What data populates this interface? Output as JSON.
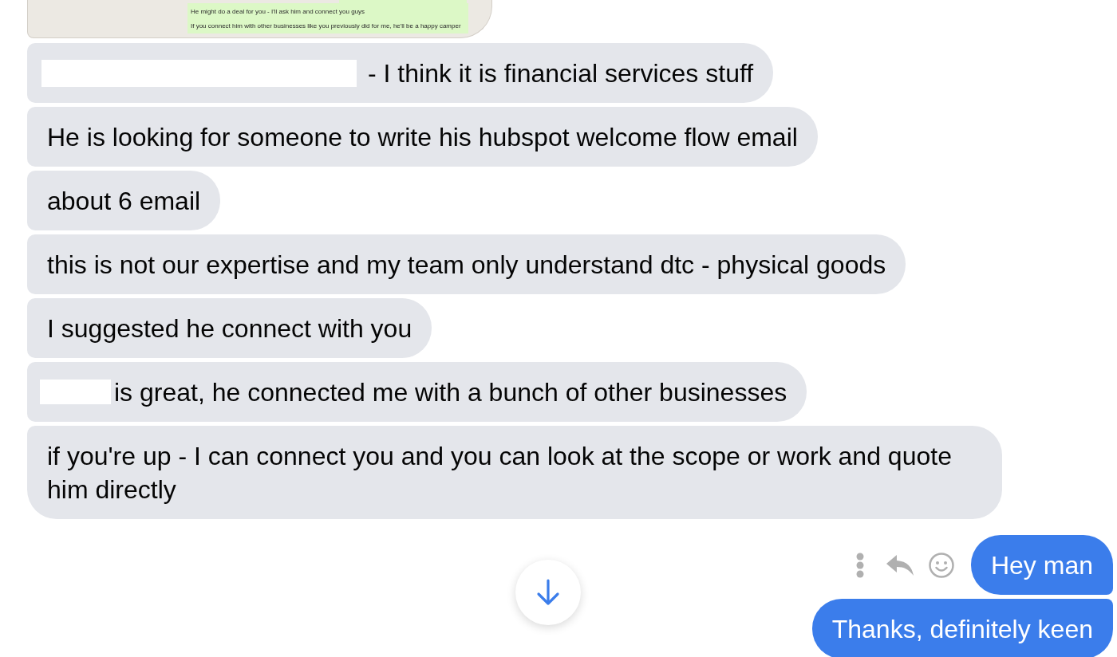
{
  "shared_image": {
    "kind": "chat-screenshot",
    "lines": [
      {
        "text": "He might do a deal for you - I'll ask him and connect you guys"
      },
      {
        "text": "If you connect him with other businesses like you previously did for me, he'll be a happy camper"
      }
    ]
  },
  "messages": [
    {
      "kind": "incoming",
      "redaction": {
        "kind": "long"
      },
      "text": "- I think it is financial services stuff",
      "hovered": false
    },
    {
      "kind": "incoming",
      "text": "He is looking for someone to write his hubspot welcome flow email",
      "hovered": false
    },
    {
      "kind": "incoming",
      "text": "about 6 email",
      "hovered": false
    },
    {
      "kind": "incoming",
      "text": "this is not our expertise and my team only understand dtc - physical goods",
      "hovered": false
    },
    {
      "kind": "incoming",
      "text": "I suggested he connect with you",
      "hovered": false
    },
    {
      "kind": "incoming",
      "redaction": {
        "kind": "short"
      },
      "text": "is great, he connected me with a bunch of other businesses",
      "hovered": false
    },
    {
      "kind": "incoming",
      "text": "if you're up - I can connect you and you can look at the scope or work and quote him directly",
      "hovered": false
    },
    {
      "kind": "outgoing",
      "text": "Hey man",
      "hovered": true
    },
    {
      "kind": "outgoing",
      "text": "Thanks, definitely keen",
      "hovered": false
    }
  ],
  "scroll_down_button": true
}
